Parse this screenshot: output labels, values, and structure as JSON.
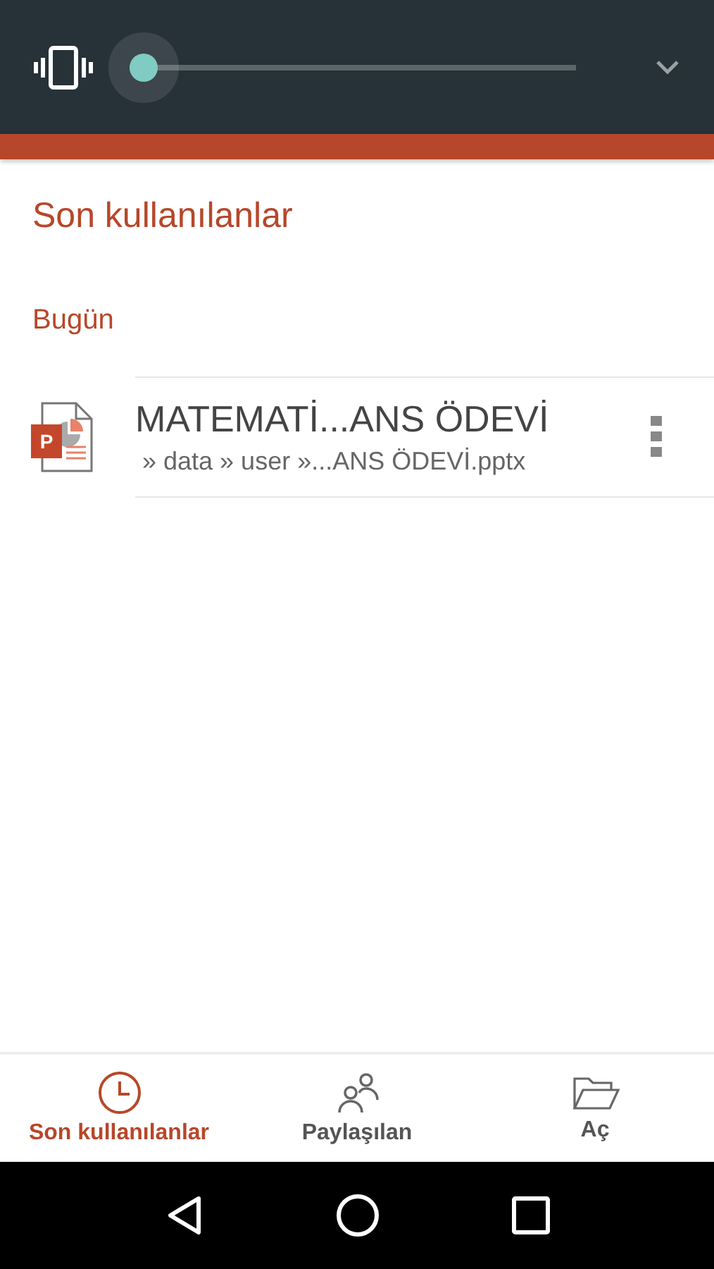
{
  "volume_panel": {
    "level": 0
  },
  "header": {
    "title": "Son kullanılanlar"
  },
  "groups": [
    {
      "label": "Bugün",
      "files": [
        {
          "name": "MATEMATİ...ANS ÖDEVİ",
          "path": "» data » user »...ANS ÖDEVİ.pptx",
          "kind": "presentation",
          "badge": "P"
        }
      ]
    }
  ],
  "bottom_tabs": [
    {
      "label": "Son kullanılanlar",
      "kind": "clock",
      "selected": true
    },
    {
      "label": "Paylaşılan",
      "kind": "people",
      "selected": false
    },
    {
      "label": "Aç",
      "kind": "folder",
      "selected": false
    }
  ]
}
